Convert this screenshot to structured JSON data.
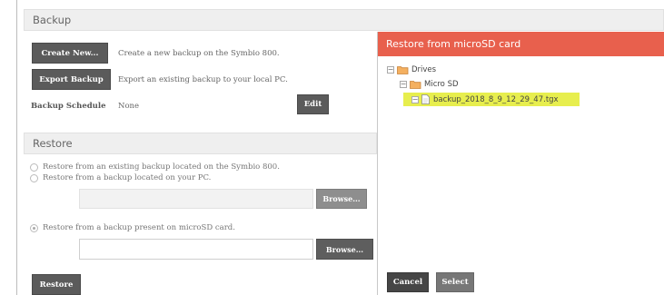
{
  "backup": {
    "title": "Backup",
    "create_button": "Create New...",
    "create_desc": "Create a new backup on the Symbio 800.",
    "export_button": "Export Backup",
    "export_desc": "Export an existing backup to your local PC.",
    "schedule_label": "Backup Schedule",
    "schedule_value": "None",
    "edit_button": "Edit"
  },
  "restore": {
    "title": "Restore",
    "option_device": "Restore from an existing backup located on the Symbio 800.",
    "option_pc": "Restore from a backup located on your PC.",
    "option_sd": "Restore from a backup present on microSD card.",
    "pc_path_value": "",
    "sd_path_value": "",
    "browse_label": "Browse...",
    "restore_button": "Restore",
    "selected_option": "sd"
  },
  "modal": {
    "title": "Restore from microSD card",
    "tree": {
      "root_label": "Drives",
      "folder_label": "Micro SD",
      "file_label": "backup_2018_8_9_12_29_47.tgx",
      "toggle_symbol": "−"
    },
    "cancel_button": "Cancel",
    "select_button": "Select"
  },
  "colors": {
    "modal_header": "#e8604d",
    "dark_button": "#5b5b5b",
    "highlight": "#e7ee4e"
  },
  "icons": [
    "folder-icon",
    "file-icon",
    "collapse-icon",
    "radio-icon"
  ]
}
